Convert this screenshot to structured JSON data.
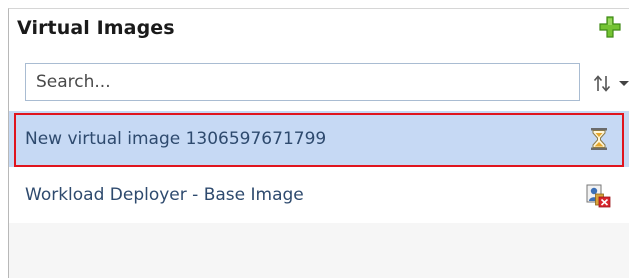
{
  "panel": {
    "title": "Virtual Images"
  },
  "search": {
    "placeholder": "Search..."
  },
  "list": {
    "items": [
      {
        "label": "New virtual image 1306597671799",
        "status_icon": "hourglass-icon",
        "selected": true
      },
      {
        "label": "Workload Deployer - Base Image",
        "status_icon": "locked-image-icon",
        "selected": false
      }
    ]
  },
  "colors": {
    "selected_row": "#c6d9f4",
    "highlight_border": "#e0141e",
    "link_text": "#2e4a6e",
    "add_icon": "#6bbf2a"
  }
}
